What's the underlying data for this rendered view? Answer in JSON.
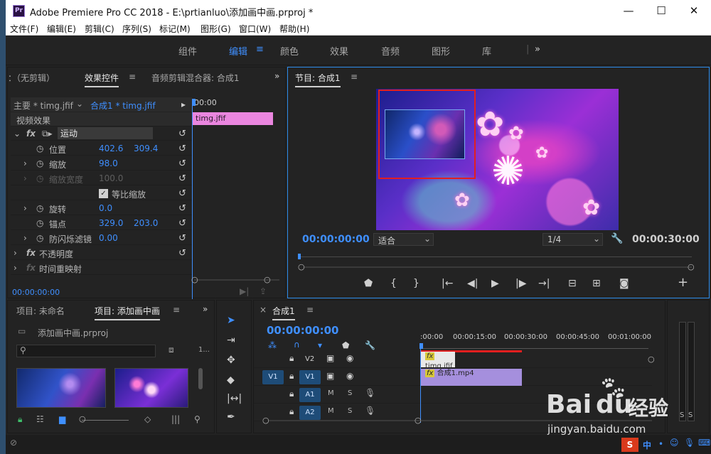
{
  "window": {
    "title": "Adobe Premiere Pro CC 2018 - E:\\prtianluo\\添加画中画.prproj *",
    "app_icon": "Pr",
    "minimize": "—",
    "maximize": "☐",
    "close": "✕"
  },
  "menu": [
    "文件(F)",
    "编辑(E)",
    "剪辑(C)",
    "序列(S)",
    "标记(M)",
    "图形(G)",
    "窗口(W)",
    "帮助(H)"
  ],
  "workspaces": {
    "items": [
      "组件",
      "编辑",
      "颜色",
      "效果",
      "音频",
      "图形",
      "库"
    ],
    "active": "编辑",
    "more": "»"
  },
  "effect_controls": {
    "source_tab": "：（无剪辑）",
    "tab_effects": "效果控件",
    "tab_mixer": "音频剪辑混合器: 合成1",
    "master_clip": "主要 * timg.jfif",
    "sequence_clip": "合成1 * timg.jfif",
    "ruler_time": "00:00",
    "section_video": "视频效果",
    "fx": "fx",
    "motion": "运动",
    "position_label": "位置",
    "position_x": "402.6",
    "position_y": "309.4",
    "scale_label": "缩放",
    "scale_value": "98.0",
    "scale_width_label": "缩放宽度",
    "scale_width_value": "100.0",
    "uniform_label": "等比缩放",
    "rotation_label": "旋转",
    "rotation_value": "0.0",
    "anchor_label": "锚点",
    "anchor_x": "329.0",
    "anchor_y": "203.0",
    "flicker_label": "防闪烁滤镜",
    "flicker_value": "0.00",
    "opacity_label": "不透明度",
    "time_remap_label": "时间重映射",
    "clip_name": "timg.jfif",
    "timecode": "00:00:00:00"
  },
  "program": {
    "tab": "节目: 合成1",
    "timecode_in": "00:00:00:00",
    "fit": "适合",
    "resolution": "1/4",
    "duration": "00:00:30:00"
  },
  "project": {
    "tab_unnamed": "项目: 未命名",
    "tab_active": "项目: 添加画中画",
    "filename": "添加画中画.prproj",
    "count": "1..."
  },
  "timeline": {
    "tab": "合成1",
    "timecode": "00:00:00:00",
    "ruler": [
      ":00:00",
      "00:00:15:00",
      "00:00:30:00",
      "00:00:45:00",
      "00:01:00:00"
    ],
    "tracks": [
      {
        "src": "",
        "name": "V2",
        "m": "",
        "s": "",
        "clip": "timg.jfif"
      },
      {
        "src": "V1",
        "name": "V1",
        "m": "",
        "s": "",
        "clip": "合成1.mp4"
      },
      {
        "src": "",
        "name": "A1",
        "m": "M",
        "s": "S",
        "clip": ""
      },
      {
        "src": "",
        "name": "A2",
        "m": "M",
        "s": "S",
        "clip": ""
      }
    ]
  },
  "meter": {
    "s1": "S",
    "s2": "S"
  },
  "watermark": {
    "brand": "Bai",
    "du": "du",
    "jy": "经验",
    "url": "jingyan.baidu.com"
  },
  "tray": {
    "ime": "中"
  },
  "colors": {
    "accent": "#3f8fff",
    "clip_video": "#a58fdd",
    "clip_pink": "#ea86df",
    "selection": "#e21f1f"
  }
}
